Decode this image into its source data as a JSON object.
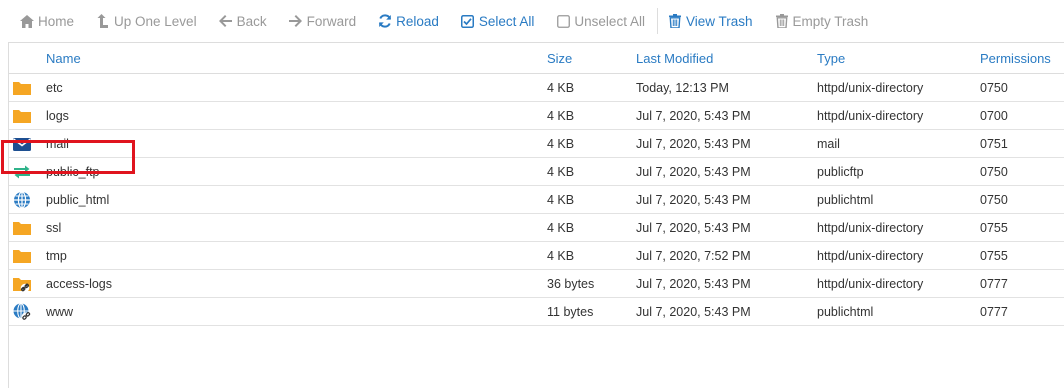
{
  "toolbar": {
    "home": "Home",
    "up_one_level": "Up One Level",
    "back": "Back",
    "forward": "Forward",
    "reload": "Reload",
    "select_all": "Select All",
    "unselect_all": "Unselect All",
    "view_trash": "View Trash",
    "empty_trash": "Empty Trash"
  },
  "columns": {
    "name": "Name",
    "size": "Size",
    "last_modified": "Last Modified",
    "type": "Type",
    "permissions": "Permissions"
  },
  "files": [
    {
      "icon": "folder-icon",
      "name": "etc",
      "size": "4 KB",
      "modified": "Today, 12:13 PM",
      "type": "httpd/unix-directory",
      "perm": "0750"
    },
    {
      "icon": "folder-icon",
      "name": "logs",
      "size": "4 KB",
      "modified": "Jul 7, 2020, 5:43 PM",
      "type": "httpd/unix-directory",
      "perm": "0700"
    },
    {
      "icon": "mail-icon",
      "name": "mail",
      "size": "4 KB",
      "modified": "Jul 7, 2020, 5:43 PM",
      "type": "mail",
      "perm": "0751"
    },
    {
      "icon": "transfer-arrows-icon",
      "name": "public_ftp",
      "size": "4 KB",
      "modified": "Jul 7, 2020, 5:43 PM",
      "type": "publicftp",
      "perm": "0750"
    },
    {
      "icon": "globe-icon",
      "name": "public_html",
      "size": "4 KB",
      "modified": "Jul 7, 2020, 5:43 PM",
      "type": "publichtml",
      "perm": "0750"
    },
    {
      "icon": "folder-icon",
      "name": "ssl",
      "size": "4 KB",
      "modified": "Jul 7, 2020, 5:43 PM",
      "type": "httpd/unix-directory",
      "perm": "0755"
    },
    {
      "icon": "folder-icon",
      "name": "tmp",
      "size": "4 KB",
      "modified": "Jul 7, 2020, 7:52 PM",
      "type": "httpd/unix-directory",
      "perm": "0755"
    },
    {
      "icon": "folder-link-icon",
      "name": "access-logs",
      "size": "36 bytes",
      "modified": "Jul 7, 2020, 5:43 PM",
      "type": "httpd/unix-directory",
      "perm": "0777"
    },
    {
      "icon": "globe-link-icon",
      "name": "www",
      "size": "11 bytes",
      "modified": "Jul 7, 2020, 5:43 PM",
      "type": "publichtml",
      "perm": "0777"
    }
  ],
  "colors": {
    "accent": "#2a7bc3",
    "folder": "#f5a623",
    "mail": "#1d4f91",
    "ftp": "#2fb38a",
    "highlight": "#e0141e"
  }
}
